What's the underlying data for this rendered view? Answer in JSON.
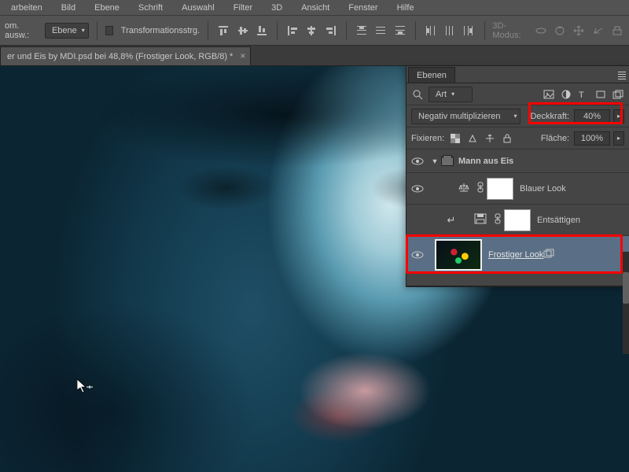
{
  "menu": {
    "items": [
      "arbeiten",
      "Bild",
      "Ebene",
      "Schrift",
      "Auswahl",
      "Filter",
      "3D",
      "Ansicht",
      "Fenster",
      "Hilfe"
    ]
  },
  "optbar": {
    "left_label": "om. ausw.:",
    "dropdown_label": "Ebene",
    "checkbox_label": "Transformationsstrg.",
    "mode3d_label": "3D-Modus:"
  },
  "doctab": {
    "label": "er und Eis by MDI.psd bei 48,8% (Frostiger Look, RGB/8) *"
  },
  "panel": {
    "title": "Ebenen",
    "filter_label": "Art",
    "blend_label": "Negativ multiplizieren",
    "opacity_label": "Deckkraft:",
    "opacity_value": "40%",
    "lock_label": "Fixieren:",
    "fill_label": "Fläche:",
    "fill_value": "100%",
    "group_name": "Mann aus Eis",
    "layer1": "Blauer Look",
    "layer2": "Entsättigen",
    "layer3": "Frostiger Look "
  }
}
